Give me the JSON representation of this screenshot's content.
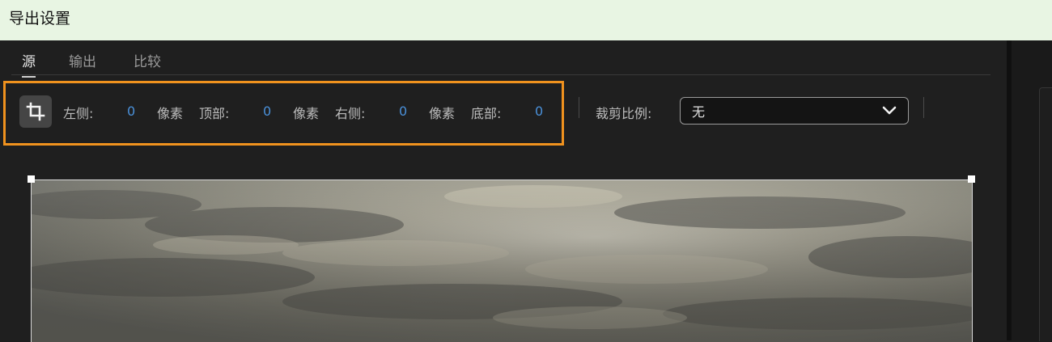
{
  "window": {
    "title": "导出设置"
  },
  "tabs": [
    {
      "label": "源",
      "active": true
    },
    {
      "label": "输出",
      "active": false
    },
    {
      "label": "比较",
      "active": false
    }
  ],
  "crop": {
    "icon": "crop-icon",
    "left": {
      "label": "左侧:",
      "value": "0",
      "unit": "像素"
    },
    "top": {
      "label": "顶部:",
      "value": "0",
      "unit": "像素"
    },
    "right": {
      "label": "右侧:",
      "value": "0",
      "unit": "像素"
    },
    "bottom": {
      "label": "底部:",
      "value": "0"
    },
    "highlight_color": "#f0921e",
    "value_color": "#4a90d9"
  },
  "aspect": {
    "label": "裁剪比例:",
    "selected": "无"
  }
}
